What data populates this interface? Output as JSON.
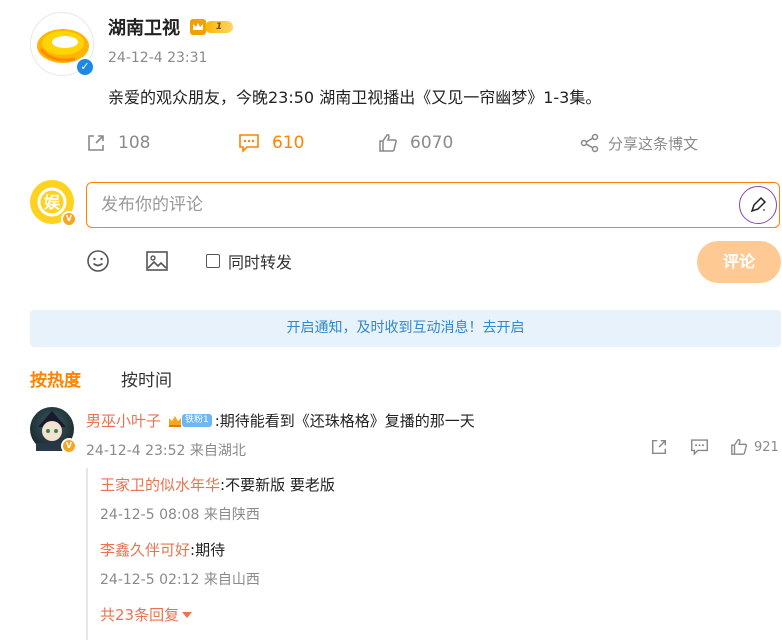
{
  "post": {
    "author": "湖南卫视",
    "vip_level": "1",
    "time": "24-12-4 23:31",
    "text": "亲爱的观众朋友，今晚23:50 湖南卫视播出《又见一帘幽梦》1-3集。",
    "reposts": "108",
    "comments": "610",
    "likes": "6070",
    "share_label": "分享这条博文"
  },
  "composer": {
    "placeholder": "发布你的评论",
    "repost_label": "同时转发",
    "submit_label": "评论"
  },
  "notice": "开启通知，及时收到互动消息！去开启",
  "sort": {
    "hot": "按热度",
    "time": "按时间"
  },
  "comment": {
    "user": "男巫小叶子",
    "fan_badge": "铁粉1",
    "text": ":期待能看到《还珠格格》复播的那一天",
    "meta": "24-12-4 23:52 来自湖北",
    "likes": "921",
    "replies": [
      {
        "user": "王家卫的似水年华",
        "text": ":不要新版 要老版",
        "meta": "24-12-5 08:08 来自陕西"
      },
      {
        "user": "李鑫久伴可好",
        "text": ":期待",
        "meta": "24-12-5 02:12 来自山西"
      }
    ],
    "more": "共23条回复"
  },
  "colors": {
    "accent": "#ff8200",
    "username": "#eb7350",
    "notice_bg": "#e7f2fb",
    "notice_text": "#2f88d0",
    "submit_disabled": "#ffc993"
  }
}
